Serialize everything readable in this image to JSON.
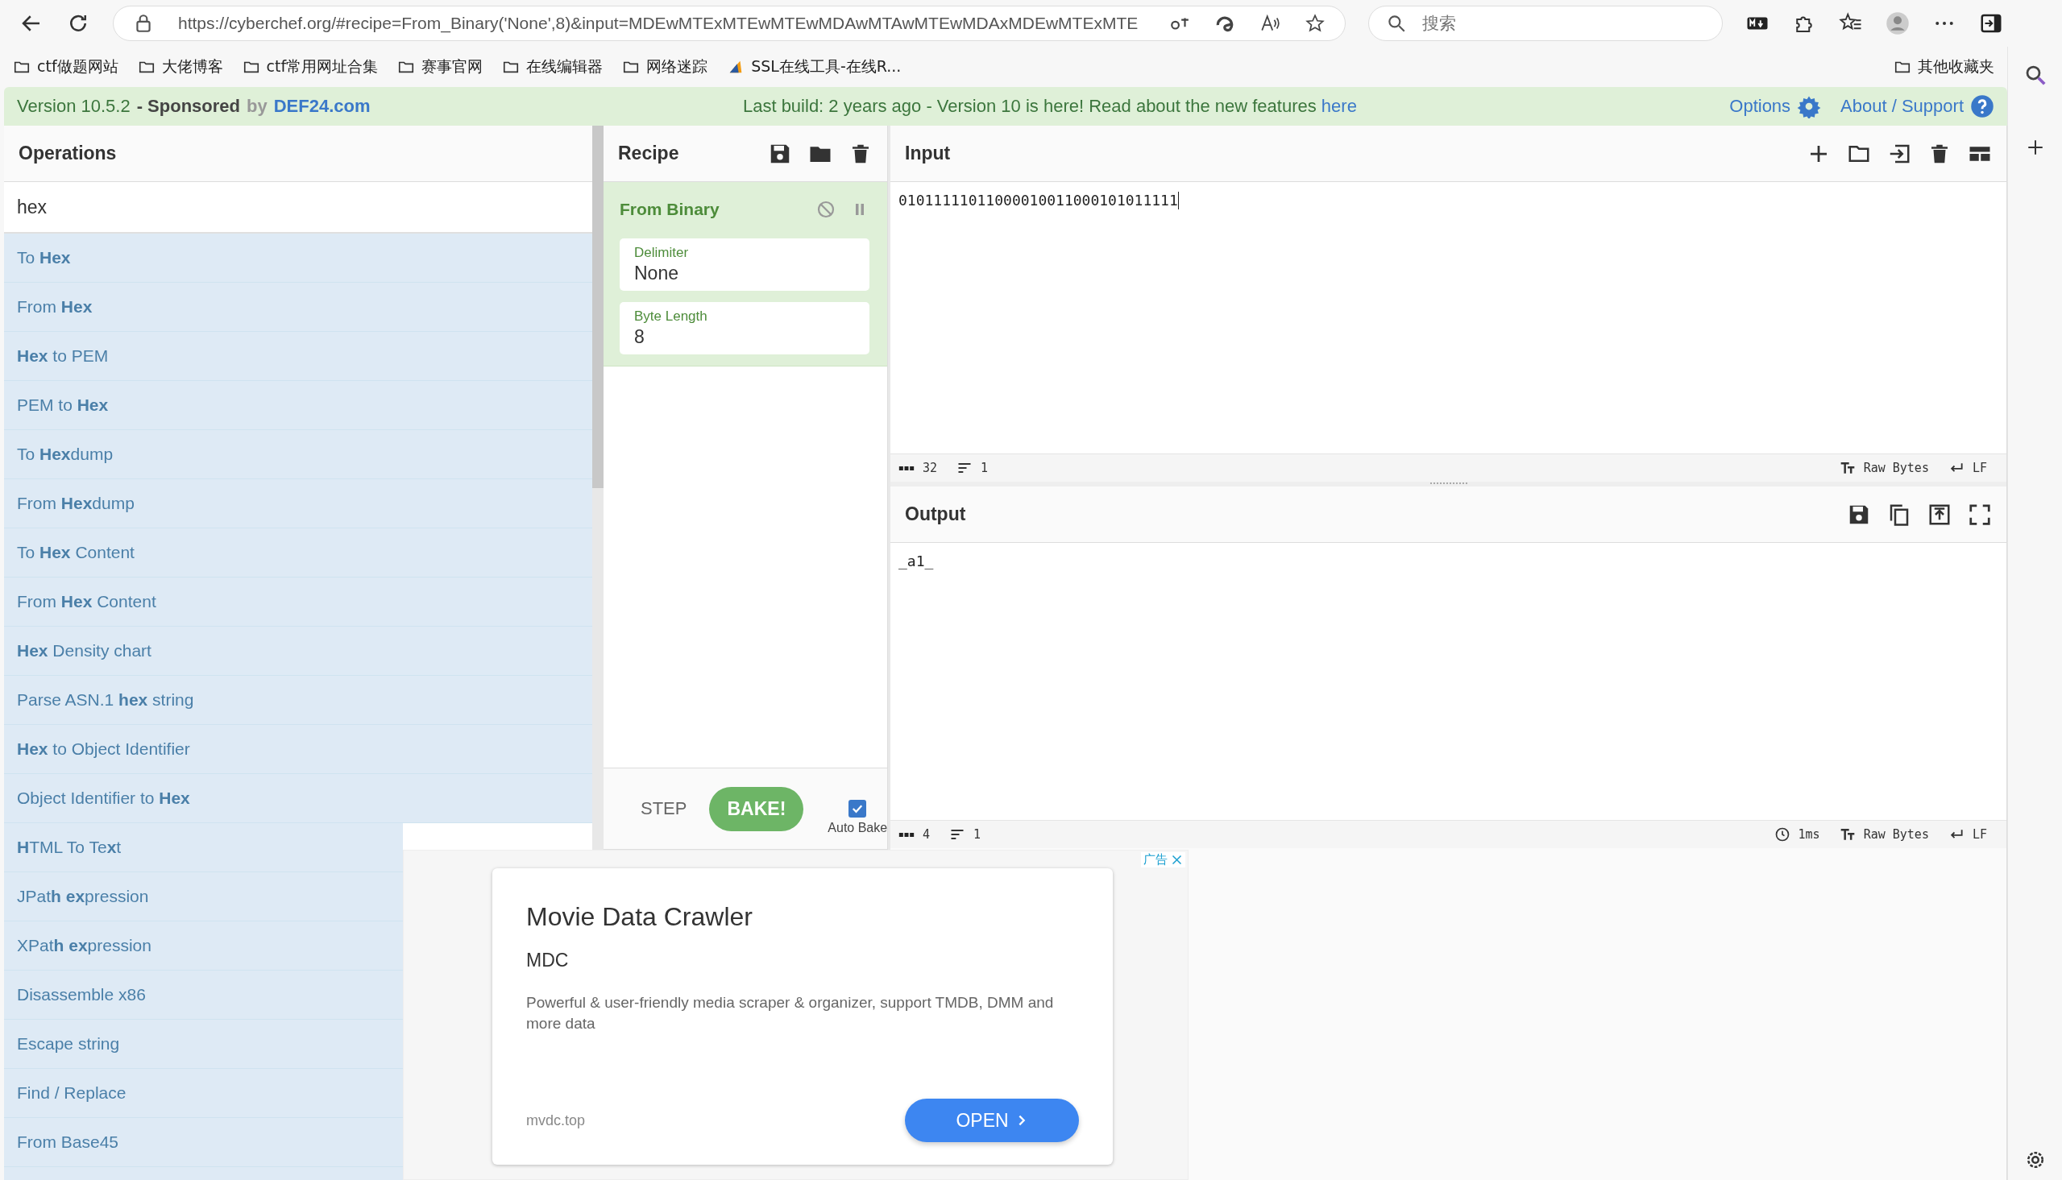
{
  "browser": {
    "url": "https://cyberchef.org/#recipe=From_Binary('None',8)&input=MDEwMTExMTEwMTEwMDAwMTAwMTEwMDAxMDEwMTExMTE",
    "search": {
      "placeholder": "搜索"
    },
    "bookmarks": [
      {
        "label": "ctf做题网站",
        "kind": "folder"
      },
      {
        "label": "大佬博客",
        "kind": "folder"
      },
      {
        "label": "ctf常用网址合集",
        "kind": "folder"
      },
      {
        "label": "赛事官网",
        "kind": "folder"
      },
      {
        "label": "在线编辑器",
        "kind": "folder"
      },
      {
        "label": "网络迷踪",
        "kind": "folder"
      },
      {
        "label": "SSL在线工具-在线R...",
        "kind": "site"
      }
    ],
    "other_bookmarks": "其他收藏夹"
  },
  "banner": {
    "version": "Version 10.5.2",
    "sponsored": "- Sponsored",
    "by": "by",
    "sponsor": "DEF24.com",
    "message": "Last build: 2 years ago - Version 10 is here! Read about the new features",
    "message_link": "here",
    "options": "Options",
    "about": "About / Support"
  },
  "operations": {
    "title": "Operations",
    "search": {
      "value": "hex"
    },
    "items": [
      {
        "label": "To **Hex**"
      },
      {
        "label": "From **Hex**"
      },
      {
        "label": "**Hex** to PEM"
      },
      {
        "label": "PEM to **Hex**"
      },
      {
        "label": "To **Hex**dump"
      },
      {
        "label": "From **Hex**dump"
      },
      {
        "label": "To **Hex** Content"
      },
      {
        "label": "From **Hex** Content"
      },
      {
        "label": "**Hex** Density chart"
      },
      {
        "label": "Parse ASN.1 **hex** string"
      },
      {
        "label": "**Hex** to Object Identifier"
      },
      {
        "label": "Object Identifier to **Hex**"
      },
      {
        "label": "**H**TML To Te**x**t"
      },
      {
        "label": "JPat**h** **ex**pression"
      },
      {
        "label": "XPat**h** **ex**pression"
      },
      {
        "label": "Disassemble x86"
      },
      {
        "label": "Escape string"
      },
      {
        "label": "Find / Replace"
      },
      {
        "label": "From Base45"
      }
    ]
  },
  "recipe": {
    "title": "Recipe",
    "operation": {
      "name": "From Binary",
      "args": [
        {
          "label": "Delimiter",
          "value": "None"
        },
        {
          "label": "Byte Length",
          "value": "8"
        }
      ]
    },
    "step": "STEP",
    "bake": "BAKE!",
    "auto_bake": {
      "label": "Auto Bake",
      "checked": true
    }
  },
  "input": {
    "title": "Input",
    "value": "01011111011000010011000101011111",
    "status": {
      "chars": "32",
      "lines": "1",
      "encoding": "Raw Bytes",
      "eol": "LF"
    }
  },
  "output": {
    "title": "Output",
    "value": "_a1_",
    "status": {
      "chars": "4",
      "lines": "1",
      "time": "1ms",
      "encoding": "Raw Bytes",
      "eol": "LF"
    }
  },
  "ad": {
    "label": "广告",
    "title": "Movie Data Crawler",
    "subtitle": "MDC",
    "description": "Powerful & user-friendly media scraper & organizer, support TMDB, DMM and more data",
    "domain": "mvdc.top",
    "button": "OPEN"
  }
}
